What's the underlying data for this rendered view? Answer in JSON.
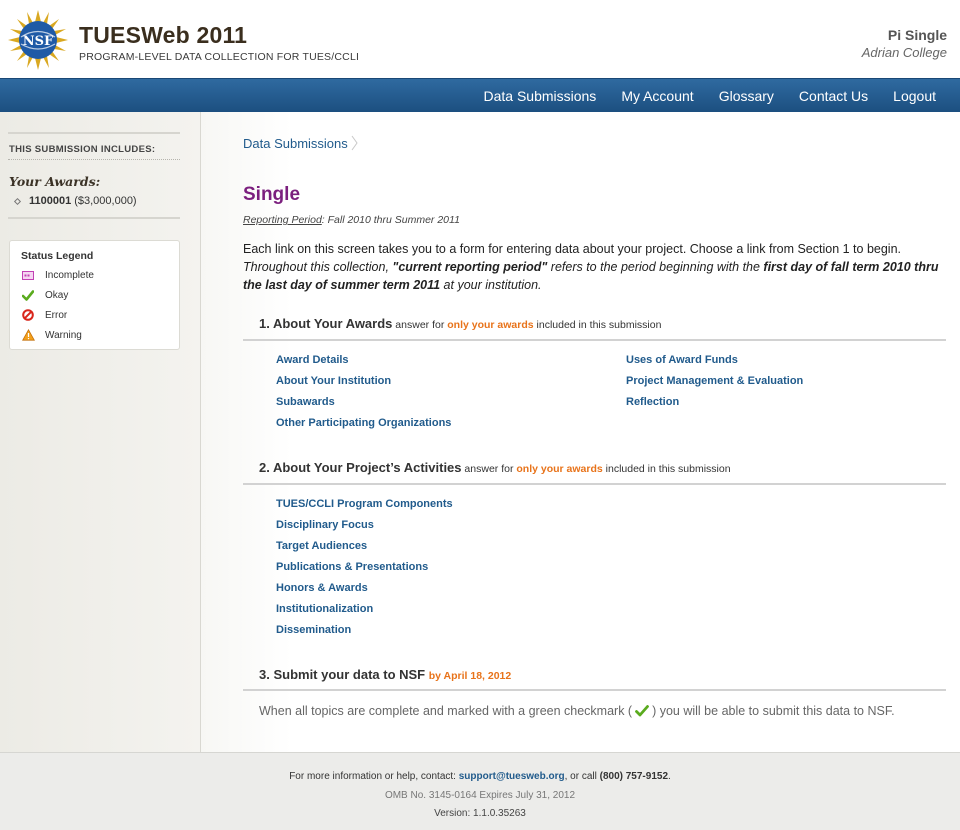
{
  "header": {
    "logo_text": "NSF",
    "title": "TUESWeb 2011",
    "subtitle": "PROGRAM-LEVEL DATA COLLECTION FOR TUES/CCLI",
    "user_name": "Pi Single",
    "user_org": "Adrian College"
  },
  "nav": {
    "items": [
      "Data Submissions",
      "My Account",
      "Glossary",
      "Contact Us",
      "Logout"
    ]
  },
  "sidebar": {
    "includes_label": "THIS SUBMISSION INCLUDES:",
    "awards_label": "Your Awards:",
    "award_id": "1100001",
    "award_amount": "($3,000,000)",
    "legend_title": "Status Legend",
    "legend": [
      {
        "label": "Incomplete",
        "icon": "incomplete-icon"
      },
      {
        "label": "Okay",
        "icon": "checkmark-icon"
      },
      {
        "label": "Error",
        "icon": "error-icon"
      },
      {
        "label": "Warning",
        "icon": "warning-icon"
      }
    ]
  },
  "main": {
    "breadcrumb": "Data Submissions",
    "title": "Single",
    "reporting_label": "Reporting Period",
    "reporting_value": ": Fall 2010 thru Summer 2011",
    "intro_1": "Each link on this screen takes you to a form for entering data about your project. Choose a link from Section 1 to begin.",
    "intro_2a": "Throughout this collection, ",
    "intro_2b": "\"current reporting period\"",
    "intro_2c": " refers to the period beginning with the ",
    "intro_2d": "first day of fall term 2010 thru the last day of summer term 2011",
    "intro_2e": " at your institution.",
    "section1": {
      "title": "1. About Your Awards",
      "pre": " answer for ",
      "highlight": "only your awards",
      "post": " included in this submission",
      "links_left": [
        "Award Details",
        "About Your Institution",
        "Subawards",
        "Other Participating Organizations"
      ],
      "links_right": [
        "Uses of Award Funds",
        "Project Management & Evaluation",
        "Reflection"
      ]
    },
    "section2": {
      "title": "2. About Your Project’s Activities",
      "pre": " answer for ",
      "highlight": "only your awards",
      "post": " included in this submission",
      "links": [
        "TUES/CCLI Program Components",
        "Disciplinary Focus",
        "Target Audiences",
        "Publications & Presentations",
        "Honors & Awards",
        "Institutionalization",
        "Dissemination"
      ]
    },
    "section3": {
      "title": "3. Submit your data to NSF",
      "deadline": "by April 18, 2012",
      "note_a": "When all topics are complete and marked with a green checkmark (",
      "note_b": ") you will be able to submit this data to NSF."
    }
  },
  "footer": {
    "line1_a": "For more information or help, contact: ",
    "email": "support@tuesweb.org",
    "line1_b": ", or call ",
    "phone": "(800) 757-9152",
    "line1_c": ".",
    "omb": "OMB No. 3145-0164 Expires July 31, 2012",
    "version": "Version: 1.1.0.35263"
  },
  "colors": {
    "nav": "#1c4f80",
    "link": "#215b8c",
    "title": "#7b1f7e",
    "highlight": "#e8731a"
  }
}
